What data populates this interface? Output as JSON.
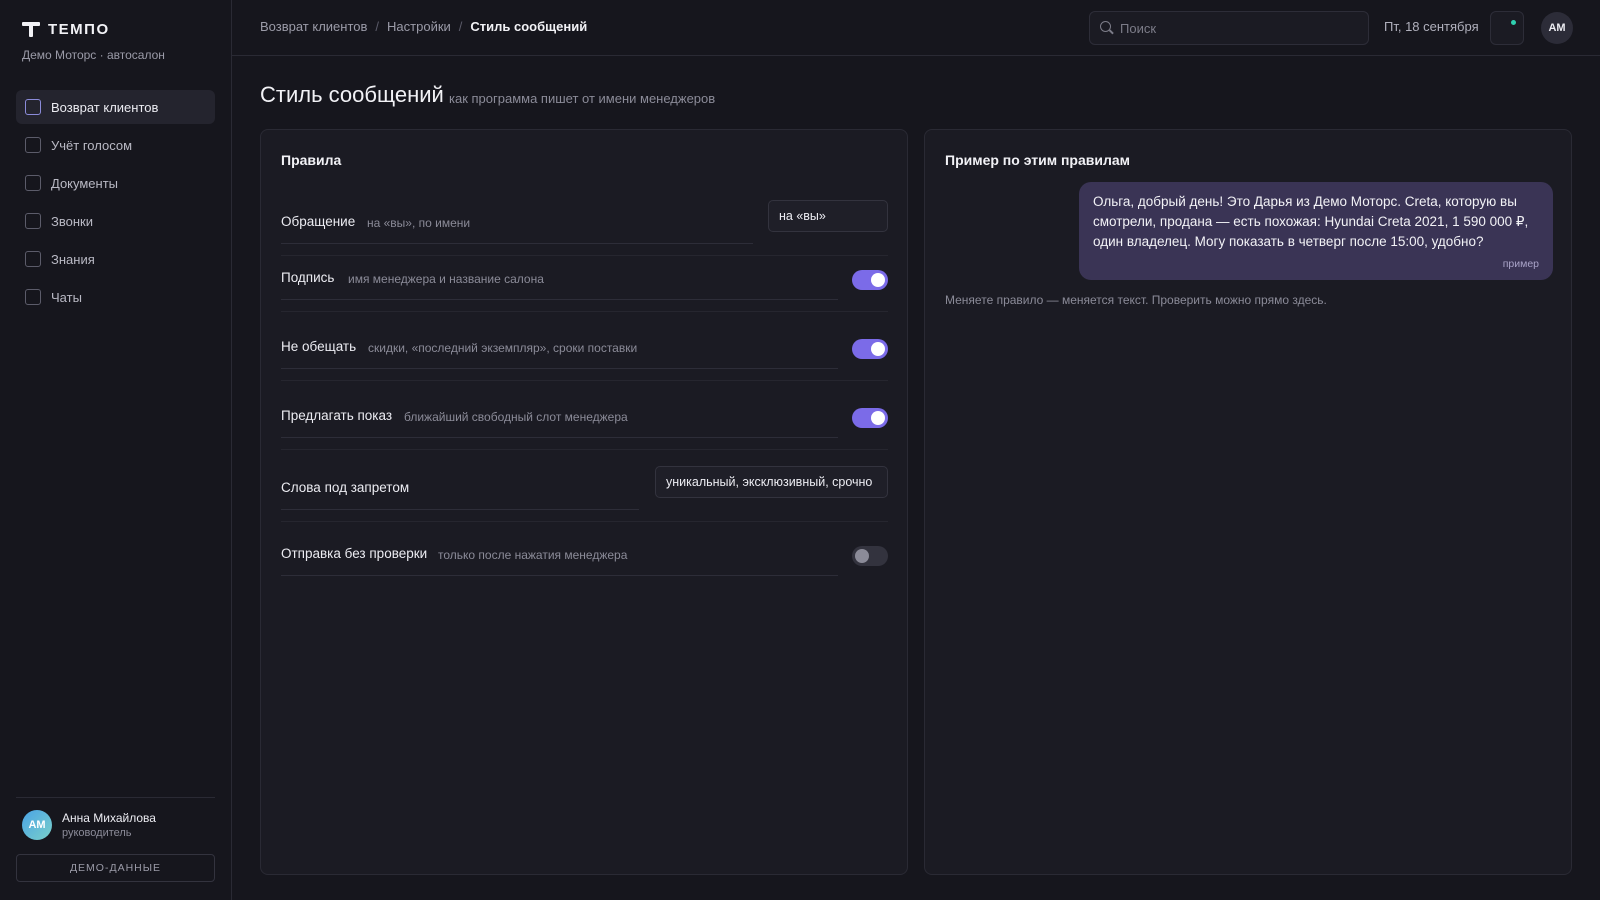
{
  "brand": {
    "name": "ТЕМПО",
    "subtitle": "Демо Моторс · автосалон"
  },
  "sidebar": {
    "items": [
      {
        "label": "Возврат клиентов",
        "active": true
      },
      {
        "label": "Учёт голосом",
        "active": false
      },
      {
        "label": "Документы",
        "active": false
      },
      {
        "label": "Звонки",
        "active": false
      },
      {
        "label": "Знания",
        "active": false
      },
      {
        "label": "Чаты",
        "active": false
      }
    ],
    "user": {
      "initials": "АМ",
      "name": "Анна Михайлова",
      "role": "руководитель"
    },
    "demo_button": "ДЕМО-ДАННЫЕ"
  },
  "header": {
    "breadcrumb": [
      "Возврат клиентов",
      "Настройки",
      "Стиль сообщений"
    ],
    "search_placeholder": "Поиск",
    "date": "Пт, 18 сентября",
    "avatar_initials": "АМ"
  },
  "page": {
    "title": "Стиль сообщений",
    "subtitle": "как программа пишет от имени менеджеров"
  },
  "rules": {
    "title": "Правила",
    "items": [
      {
        "label": "Обращение",
        "hint": "на «вы», по имени",
        "control": "input",
        "value": "на «вы»"
      },
      {
        "label": "Подпись",
        "hint": "имя менеджера и название салона",
        "control": "toggle",
        "on": true
      },
      {
        "label": "Не обещать",
        "hint": "скидки, «последний экземпляр», сроки поставки",
        "control": "toggle",
        "on": true
      },
      {
        "label": "Предлагать показ",
        "hint": "ближайший свободный слот менеджера",
        "control": "toggle",
        "on": true
      },
      {
        "label": "Слова под запретом",
        "hint": "",
        "control": "input",
        "value": "уникальный, эксклюзивный, срочно"
      },
      {
        "label": "Отправка без проверки",
        "hint": "только после нажатия менеджера",
        "control": "toggle",
        "on": false
      }
    ]
  },
  "example": {
    "title": "Пример по этим правилам",
    "message": "Ольга, добрый день! Это Дарья из Демо Моторс. Creta, которую вы смотрели, продана — есть похожая: Hyundai Creta 2021, 1 590 000 ₽, один владелец. Могу показать в четверг после 15:00, удобно?",
    "tag": "пример",
    "note": "Меняете правило — меняется текст. Проверить можно прямо здесь."
  },
  "colors": {
    "accent": "#7b6be8",
    "bubble": "#3a3455",
    "background": "#16161d",
    "notification": "#2fd0b0"
  }
}
